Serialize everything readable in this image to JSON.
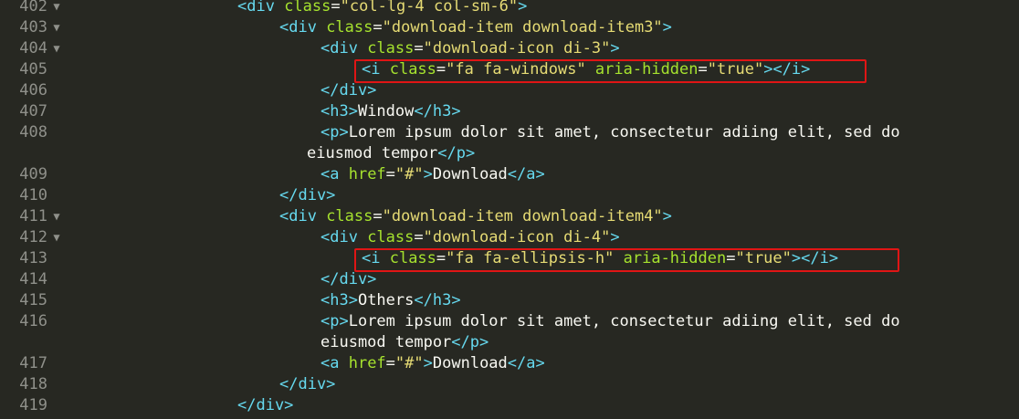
{
  "lines": [
    {
      "num": "402",
      "fold": true,
      "tokens": [
        [
          "tag",
          "<div "
        ],
        [
          "attr",
          "class"
        ],
        [
          "eq",
          "="
        ],
        [
          "str",
          "\"col-lg-4 col-sm-6\""
        ],
        [
          "tag",
          ">"
        ]
      ]
    },
    {
      "num": "403",
      "fold": true,
      "tokens": [
        [
          "tag",
          "<div "
        ],
        [
          "attr",
          "class"
        ],
        [
          "eq",
          "="
        ],
        [
          "str",
          "\"download-item download-item3\""
        ],
        [
          "tag",
          ">"
        ]
      ]
    },
    {
      "num": "404",
      "fold": true,
      "tokens": [
        [
          "tag",
          "<div "
        ],
        [
          "attr",
          "class"
        ],
        [
          "eq",
          "="
        ],
        [
          "str",
          "\"download-icon di-3\""
        ],
        [
          "tag",
          ">"
        ]
      ]
    },
    {
      "num": "405",
      "fold": false,
      "tokens": [
        [
          "tag",
          "<i "
        ],
        [
          "attr",
          "class"
        ],
        [
          "eq",
          "="
        ],
        [
          "str",
          "\"fa fa-windows\""
        ],
        [
          "attr",
          " aria-hidden"
        ],
        [
          "eq",
          "="
        ],
        [
          "str",
          "\"true\""
        ],
        [
          "tag",
          "></i>"
        ]
      ]
    },
    {
      "num": "406",
      "fold": false,
      "tokens": [
        [
          "tag",
          "</div>"
        ]
      ]
    },
    {
      "num": "407",
      "fold": false,
      "tokens": [
        [
          "tag",
          "<h3>"
        ],
        [
          "txt",
          "Window"
        ],
        [
          "tag",
          "</h3>"
        ]
      ]
    },
    {
      "num": "408",
      "fold": false,
      "tokens": [
        [
          "tag",
          "<p>"
        ],
        [
          "txt",
          "Lorem ipsum dolor sit amet, consectetur adiing elit, sed do"
        ]
      ]
    },
    {
      "num": "",
      "fold": false,
      "tokens": [
        [
          "txt",
          "eiusmod tempor"
        ],
        [
          "tag",
          "</p>"
        ]
      ]
    },
    {
      "num": "409",
      "fold": false,
      "tokens": [
        [
          "tag",
          "<a "
        ],
        [
          "attr",
          "href"
        ],
        [
          "eq",
          "="
        ],
        [
          "str",
          "\"#\""
        ],
        [
          "tag",
          ">"
        ],
        [
          "txt",
          "Download"
        ],
        [
          "tag",
          "</a>"
        ]
      ]
    },
    {
      "num": "410",
      "fold": false,
      "tokens": [
        [
          "tag",
          "</div>"
        ]
      ]
    },
    {
      "num": "411",
      "fold": true,
      "tokens": [
        [
          "tag",
          "<div "
        ],
        [
          "attr",
          "class"
        ],
        [
          "eq",
          "="
        ],
        [
          "str",
          "\"download-item download-item4\""
        ],
        [
          "tag",
          ">"
        ]
      ]
    },
    {
      "num": "412",
      "fold": true,
      "tokens": [
        [
          "tag",
          "<div "
        ],
        [
          "attr",
          "class"
        ],
        [
          "eq",
          "="
        ],
        [
          "str",
          "\"download-icon di-4\""
        ],
        [
          "tag",
          ">"
        ]
      ]
    },
    {
      "num": "413",
      "fold": false,
      "tokens": [
        [
          "tag",
          "<i "
        ],
        [
          "attr",
          "class"
        ],
        [
          "eq",
          "="
        ],
        [
          "str",
          "\"fa fa-ellipsis-h\""
        ],
        [
          "attr",
          " aria-hidden"
        ],
        [
          "eq",
          "="
        ],
        [
          "str",
          "\"true\""
        ],
        [
          "tag",
          "></i>"
        ]
      ]
    },
    {
      "num": "414",
      "fold": false,
      "tokens": [
        [
          "tag",
          "</div>"
        ]
      ]
    },
    {
      "num": "415",
      "fold": false,
      "tokens": [
        [
          "tag",
          "<h3>"
        ],
        [
          "txt",
          "Others"
        ],
        [
          "tag",
          "</h3>"
        ]
      ]
    },
    {
      "num": "416",
      "fold": false,
      "tokens": [
        [
          "tag",
          "<p>"
        ],
        [
          "txt",
          "Lorem ipsum dolor sit amet, consectetur adiing elit, sed do"
        ]
      ]
    },
    {
      "num": "",
      "fold": false,
      "tokens": [
        [
          "txt",
          "eiusmod tempor"
        ],
        [
          "tag",
          "</p>"
        ]
      ]
    },
    {
      "num": "417",
      "fold": false,
      "tokens": [
        [
          "tag",
          "<a "
        ],
        [
          "attr",
          "href"
        ],
        [
          "eq",
          "="
        ],
        [
          "str",
          "\"#\""
        ],
        [
          "tag",
          ">"
        ],
        [
          "txt",
          "Download"
        ],
        [
          "tag",
          "</a>"
        ]
      ]
    },
    {
      "num": "418",
      "fold": false,
      "tokens": [
        [
          "tag",
          "</div>"
        ]
      ]
    },
    {
      "num": "419",
      "fold": false,
      "tokens": [
        [
          "tag",
          "</div>"
        ]
      ]
    }
  ],
  "fold_glyph": "▼",
  "colors": {
    "background": "#272822",
    "tag": "#66d9ef",
    "attribute": "#a6e22e",
    "string": "#e6db74",
    "text": "#f8f8f2",
    "highlight_box": "#e01515"
  }
}
